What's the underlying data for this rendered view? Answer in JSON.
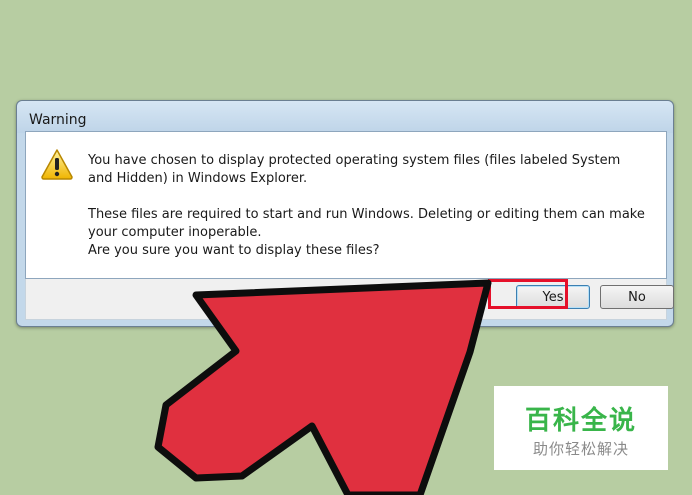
{
  "dialog": {
    "title": "Warning",
    "icon": "warning-triangle-icon",
    "message_line1": "You have chosen to display protected operating system files (files labeled System and Hidden) in Windows Explorer.",
    "message_line2": "These files are required to start and run Windows. Deleting or editing them can make your computer inoperable.",
    "message_line3": "Are you sure you want to display these files?",
    "yes_label": "Yes",
    "no_label": "No"
  },
  "annotation": {
    "highlight_target": "yes-button",
    "highlight_color": "#e5102a",
    "arrow_color": "#e0303f"
  },
  "watermark": {
    "main": "百科全说",
    "sub": "助你轻松解决",
    "color": "#39b54a"
  },
  "colors": {
    "background": "#b7cda2"
  }
}
